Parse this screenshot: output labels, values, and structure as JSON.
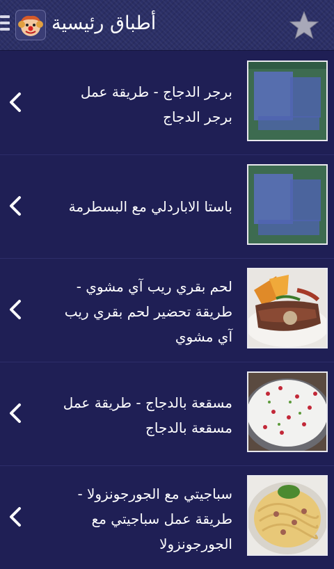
{
  "header": {
    "title": "أطباق رئيسية",
    "favorite_icon": "star-icon",
    "menu_icon": "hamburger-menu-icon",
    "app_icon": "clown-avatar-icon"
  },
  "recipes": [
    {
      "title": "برجر الدجاج - طريقة عمل برجر الدجاج",
      "image": "placeholder-thumbnail"
    },
    {
      "title": "باستا الاباردلي مع البسطرمة",
      "image": "placeholder-thumbnail"
    },
    {
      "title": "لحم بقري ريب آي مشوي - طريقة تحضير لحم بقري ريب آي مشوي",
      "image": "grilled-ribeye-photo"
    },
    {
      "title": "مسقعة بالدجاج - طريقة عمل مسقعة بالدجاج",
      "image": "chicken-musaqa-photo"
    },
    {
      "title": "سباجيتي مع الجورجونزولا - طريقة عمل سباجيتي مع الجورجونزولا",
      "image": "spaghetti-gorgonzola-photo"
    }
  ],
  "colors": {
    "background": "#1f1f55",
    "header": "#2b2f66",
    "text": "#ffffff"
  }
}
